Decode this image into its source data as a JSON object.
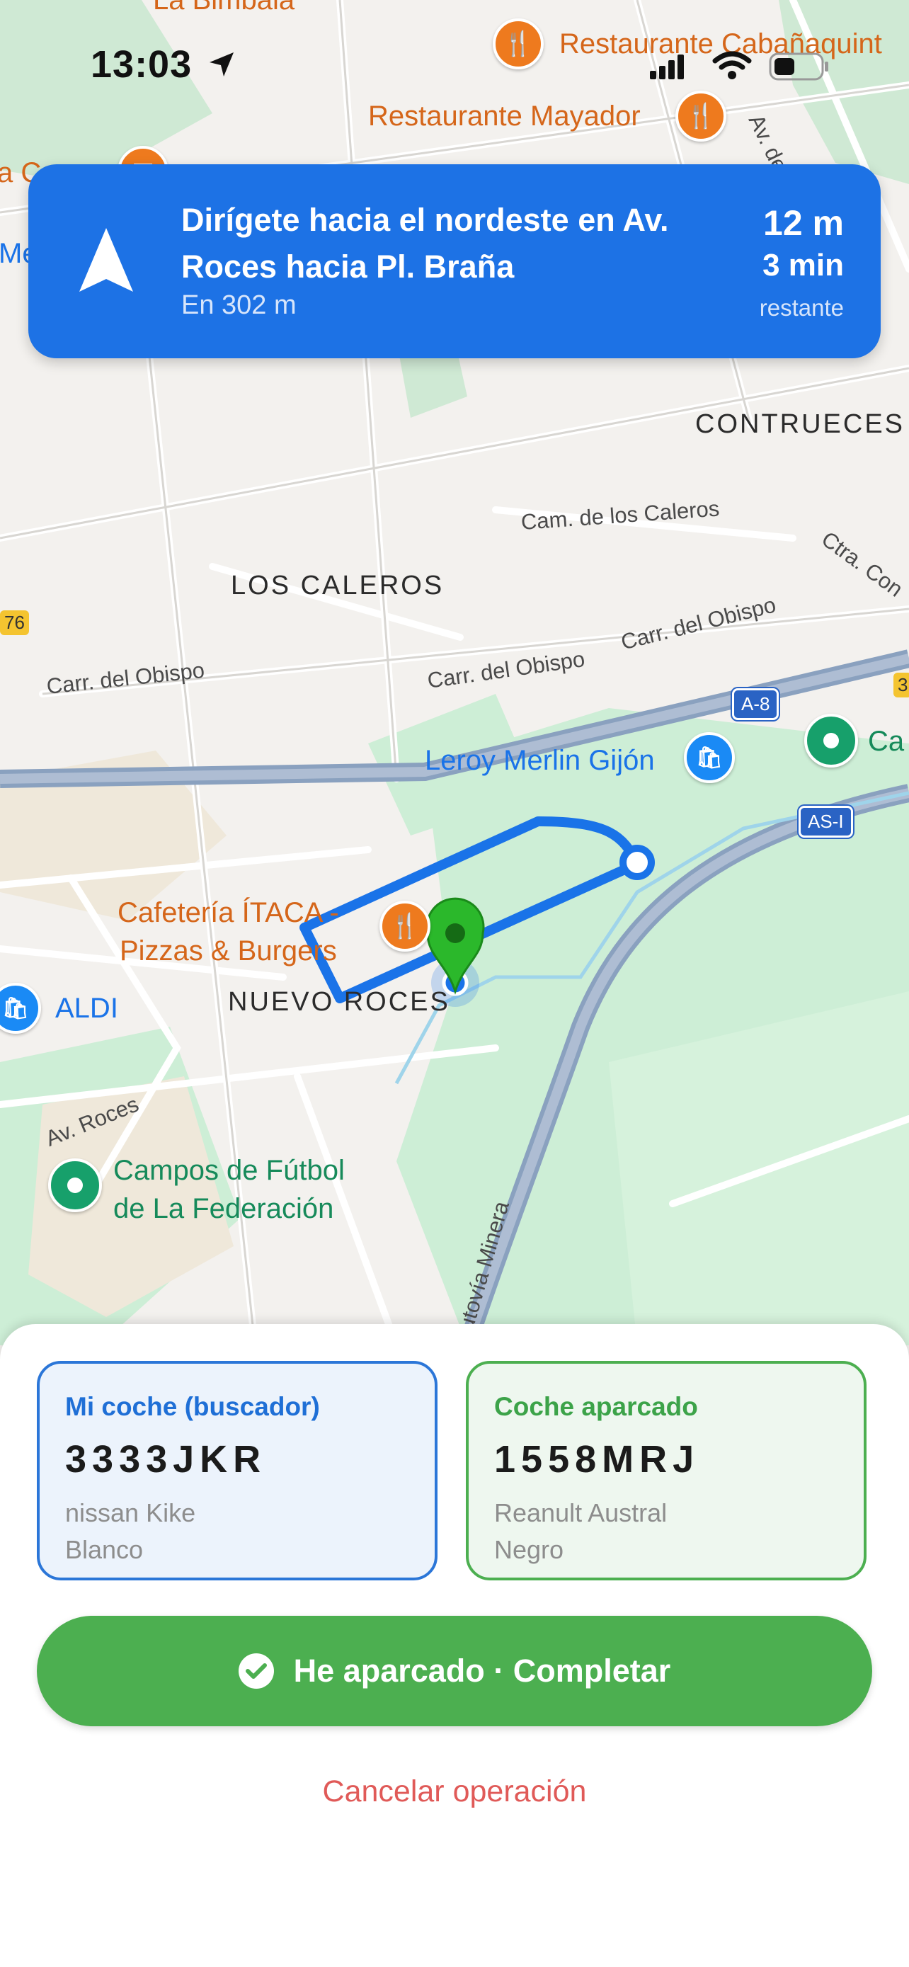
{
  "status_bar": {
    "time": "13:03",
    "icons": [
      "location-arrow-icon",
      "signal-icon",
      "wifi-icon",
      "battery-icon"
    ]
  },
  "navigation": {
    "instruction": "Dirígete hacia el nordeste en Av. Roces hacia Pl. Braña",
    "instruction_distance": "En 302 m",
    "remaining_distance": "12 m",
    "remaining_time": "3 min",
    "remaining_label": "restante",
    "arrow_icon": "navigation-arrow-icon",
    "color": "#1d72e5"
  },
  "map": {
    "areas": [
      "CONTRUECES",
      "LOS CALEROS",
      "NUEVO ROCES"
    ],
    "streets": [
      "Cam. de los Caleros",
      "Carr. del Obispo",
      "Carr. del Obispo",
      "Carr. del Obispo",
      "Av. Roces",
      "Autovía Minera",
      "Av. del L",
      "Ctra. Con"
    ],
    "route_shields": [
      "A-8",
      "AS-I"
    ],
    "edge_shields": [
      "76",
      "3"
    ],
    "pois": {
      "restaurant_top": "Restaurante Cabañaquint",
      "restaurant_mayador": "Restaurante Mayador",
      "la_bimbala": "La Bimbala",
      "leroy": "Leroy Merlin Gijón",
      "cafeteria": "Cafetería ÍTACA -\nPizzas & Burgers",
      "aldi": "ALDI",
      "campos": "Campos de Fútbol\nde La Federación",
      "edge_green": "Ca",
      "edge_left": "a C",
      "edge_left2": "Me"
    },
    "route_color": "#1a73e8",
    "destination_color": "#2bb82b"
  },
  "cards": {
    "mine": {
      "title": "Mi coche (buscador)",
      "plate": "3333JKR",
      "model": "nissan Kike",
      "color": "Blanco"
    },
    "parked": {
      "title": "Coche aparcado",
      "plate": "1558MRJ",
      "model": "Reanult Austral",
      "color": "Negro"
    }
  },
  "actions": {
    "complete": "He aparcado · Completar",
    "cancel": "Cancelar operación"
  }
}
